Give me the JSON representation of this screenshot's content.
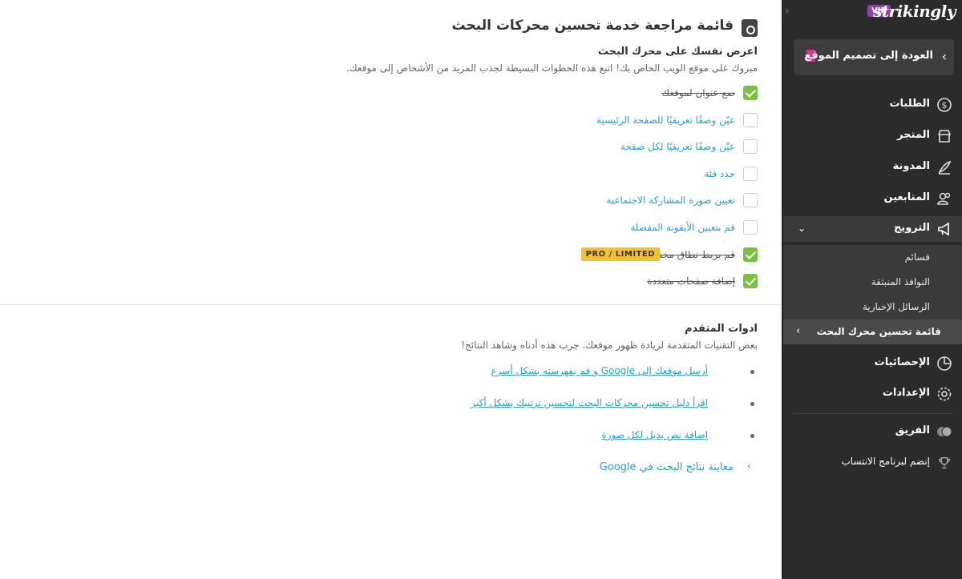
{
  "sidebar": {
    "brand": "strikingly",
    "vip_badge": "VIP",
    "collapse_label": "›",
    "back_button": "العودة إلى تصميم الموقع",
    "nav": {
      "orders": "الطلبات",
      "store": "المتجر",
      "blog": "المدونة",
      "followers": "المتابعين",
      "promotion": "الترويج",
      "stats": "الإحصائيات",
      "settings": "الإعدادات",
      "team": "الفريق",
      "affiliate": "إنضم لبرنامج الانتساب"
    },
    "promotion_sub": {
      "coupons": "قسائم",
      "popups": "النوافذ المنبثقة",
      "newsletters": "الرسائل الإخبارية",
      "seo_checklist": "قائمة تحسين محرك البحث"
    },
    "colors": {
      "background": "#2b2b2b",
      "vip": "#8e44ad",
      "back_icon": "#d6338a"
    }
  },
  "main": {
    "title": "قائمة مراجعة خدمة تحسين محركات البحث",
    "section1": {
      "heading": "اعرض نفسك على محرك البحث",
      "subtitle": "مبروك على موقع الويب الخاص بك! اتبع هذه الخطوات البسيطة لجذب المزيد من الأشخاص إلى موقعك.",
      "items": [
        {
          "label": "ضع عنوان لموقعك",
          "checked": true
        },
        {
          "label": "عيّن وصفًا تعريفيًا للصفحة الرئيسية",
          "checked": false
        },
        {
          "label": "عيّن وصفًا تعريفيًا لكل صفحة",
          "checked": false
        },
        {
          "label": "حدد فئة",
          "checked": false
        },
        {
          "label": "تعيين صورة المشاركة الاجتماعية",
          "checked": false
        },
        {
          "label": "قم بتعيين الأيقونة المفضلة",
          "checked": false
        },
        {
          "label": "قم بربط نطاق مخصص",
          "checked": true,
          "badge": "PRO / LIMITED"
        },
        {
          "label": "إضافة صفحات متعددة",
          "checked": true
        }
      ]
    },
    "section2": {
      "heading": "ادوات المتقدم",
      "subtitle": "بعض التقنيات المتقدمة لزيادة ظهور موقعك. جرب هذه أدناه وشاهد النتائج!",
      "links": [
        "أرسل موقعك إلى Google و قم بفهرسته بشكل أسرع",
        "اقرأ دليل تحسين محركات البحث لتحسين ترتيبك بشكل أكبر",
        "إضافة نص بديل لكل صورة"
      ],
      "preview": "معاينة نتائج البحث في Google"
    },
    "colors": {
      "check": "#7ac142",
      "link": "#2b9fd8",
      "badge": "#f2c12e"
    }
  }
}
